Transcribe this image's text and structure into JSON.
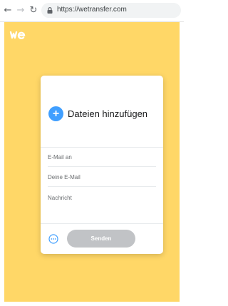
{
  "browser": {
    "back_icon": "arrow-left-icon",
    "forward_icon": "arrow-right-icon",
    "reload_icon": "reload-icon",
    "url": "https://wetransfer.com"
  },
  "page": {
    "background_color": "#ffd767",
    "logo_text": "we"
  },
  "upload_card": {
    "add_files_label": "Dateien hinzufügen",
    "fields": [
      {
        "placeholder": "E-Mail an"
      },
      {
        "placeholder": "Deine E-Mail"
      },
      {
        "placeholder": "Nachricht"
      }
    ],
    "more_options_icon": "more-options-icon",
    "send_label": "Senden",
    "accent_color": "#409fff"
  }
}
